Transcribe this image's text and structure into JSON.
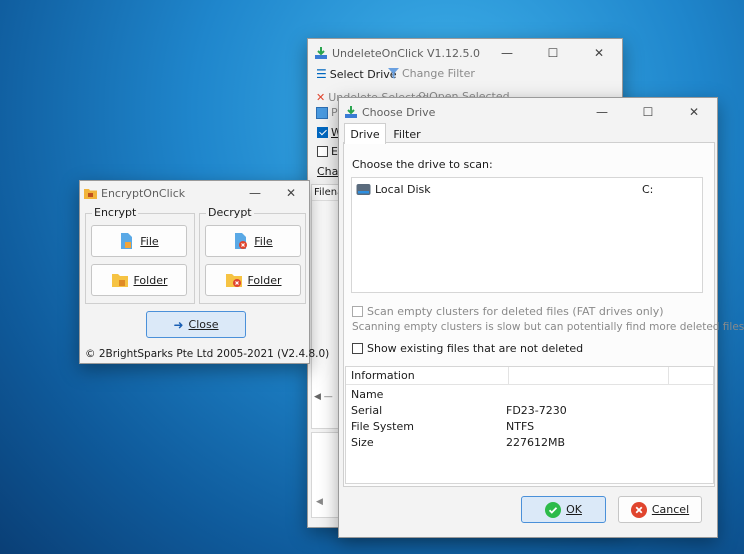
{
  "undelete": {
    "title": "UndeleteOnClick V1.12.5.0",
    "toolbar1": {
      "select_drive": "Select Drive",
      "change_filter": "Change Filter"
    },
    "toolbar2": {
      "undelete_selected": "Undelete Selected",
      "open_selected": "Open Selected"
    },
    "row3_text": "Pr",
    "row4_text": "W",
    "row5_text": "E",
    "row6_text": "Char",
    "list_header": "Filena"
  },
  "choose_drive": {
    "title": "Choose Drive",
    "tabs": [
      "Drive",
      "Filter"
    ],
    "prompt": "Choose the drive to scan:",
    "drives": [
      {
        "name": "Local Disk",
        "letter": "C:"
      }
    ],
    "scan_empty": "Scan empty clusters for deleted files (FAT drives only)",
    "scan_note": "Scanning empty clusters is slow but can potentially find more deleted files.",
    "show_existing": "Show existing files that are not deleted",
    "info_header": "Information",
    "info_rows": [
      {
        "key": "Name",
        "value": ""
      },
      {
        "key": "Serial",
        "value": "FD23-7230"
      },
      {
        "key": "File System",
        "value": "NTFS"
      },
      {
        "key": "Size",
        "value": "227612MB"
      }
    ],
    "ok": "OK",
    "cancel": "Cancel"
  },
  "encrypt": {
    "title": "EncryptOnClick",
    "encrypt_label": "Encrypt",
    "decrypt_label": "Decrypt",
    "file": "File",
    "folder": "Folder",
    "close": "Close",
    "copyright": "© 2BrightSparks Pte Ltd 2005-2021 (V2.4.8.0)"
  },
  "colors": {
    "accent": "#0067c0",
    "danger": "#e0452e",
    "ok_green": "#2dbb4a",
    "desktop": "#1f86cc"
  }
}
